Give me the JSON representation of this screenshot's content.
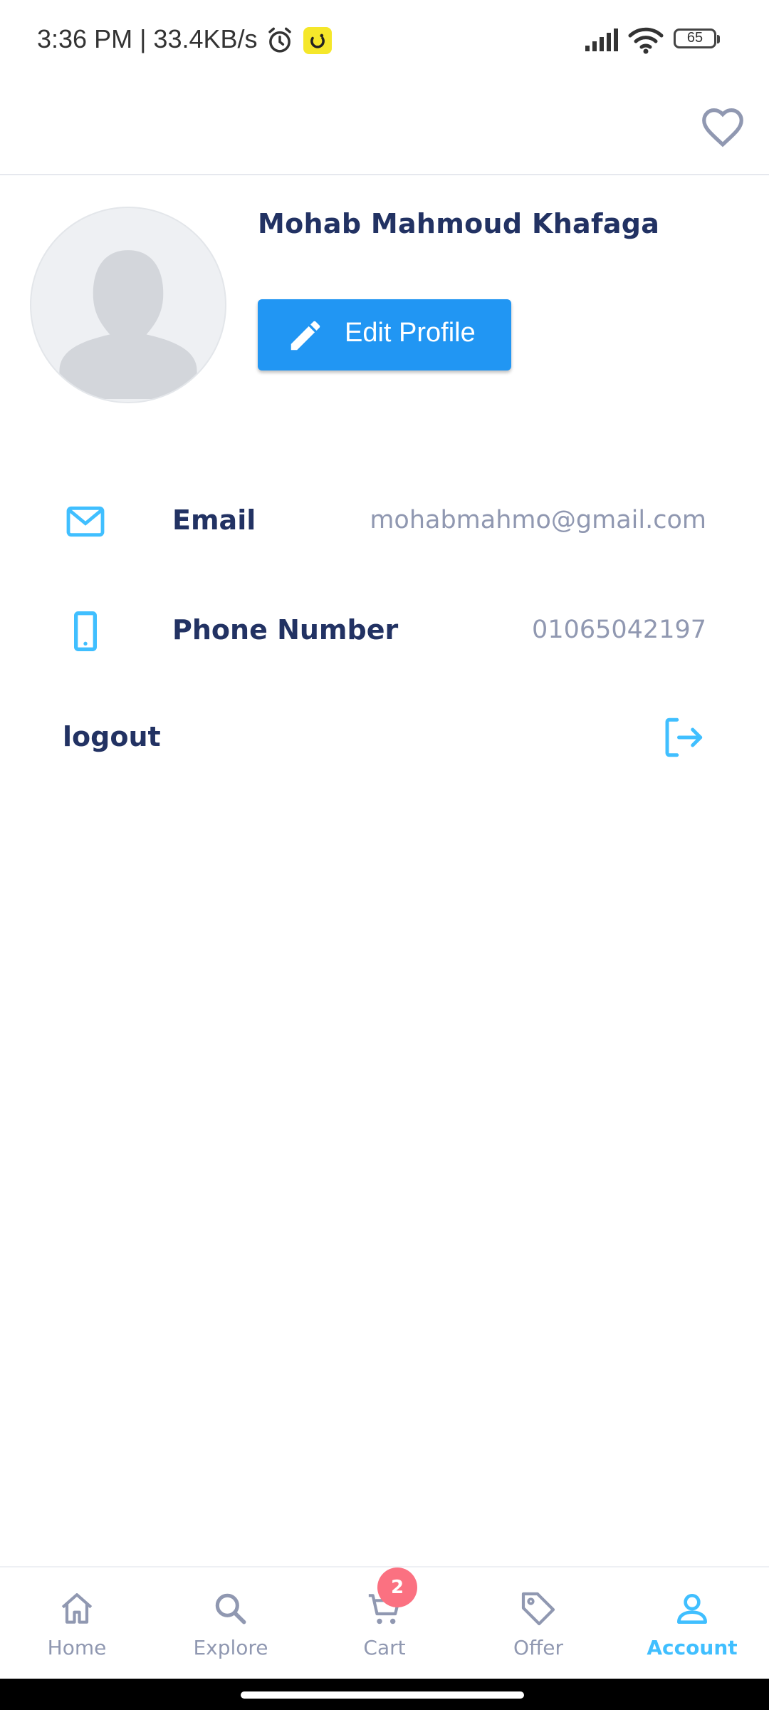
{
  "status_bar": {
    "text": "3:36 PM | 33.4KB/s",
    "battery": "65"
  },
  "profile": {
    "name": "Mohab Mahmoud Khafaga",
    "edit_label": "Edit Profile"
  },
  "info": {
    "email_label": "Email",
    "email_value": "mohabmahmo@gmail.com",
    "phone_label": "Phone Number",
    "phone_value": "01065042197"
  },
  "logout_label": "logout",
  "nav": {
    "home": "Home",
    "explore": "Explore",
    "cart": "Cart",
    "cart_badge": "2",
    "offer": "Offer",
    "account": "Account"
  },
  "colors": {
    "primary_text": "#223263",
    "muted_text": "#9098b1",
    "accent": "#40bfff",
    "button": "#2196f3",
    "badge": "#fb7181"
  },
  "icons": [
    "alarm-icon",
    "heart-icon",
    "pencil-icon",
    "mail-icon",
    "phone-icon",
    "logout-icon",
    "home-icon",
    "search-icon",
    "cart-icon",
    "tag-icon",
    "user-icon"
  ]
}
